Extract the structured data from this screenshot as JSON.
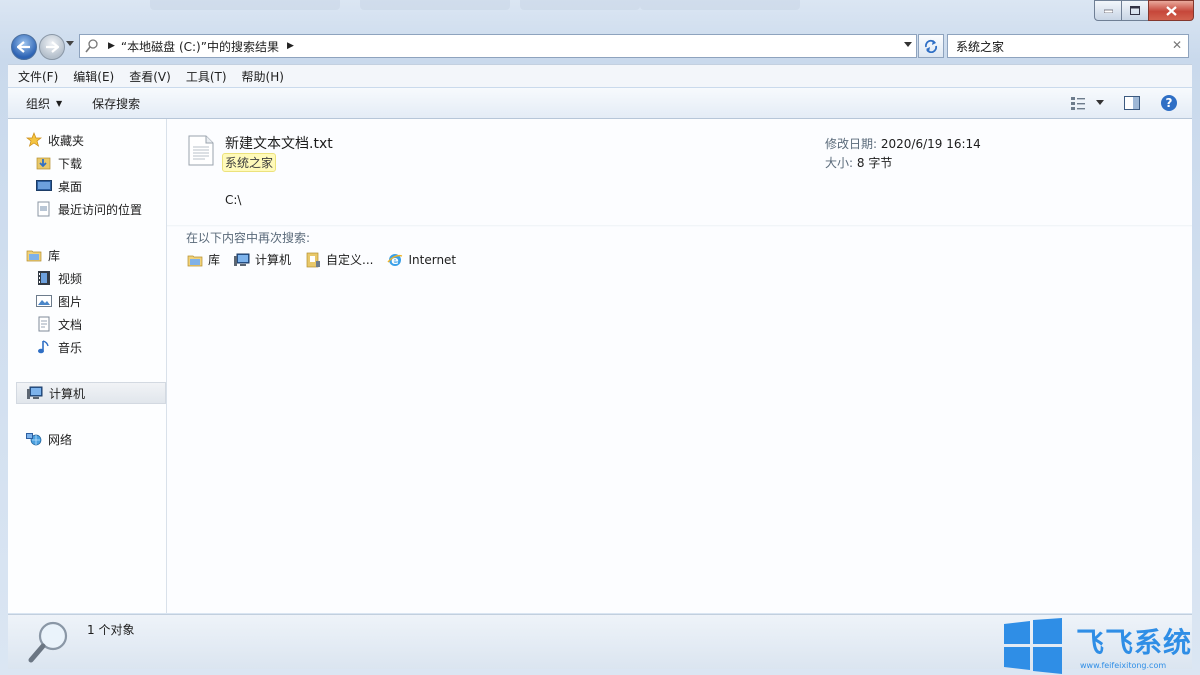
{
  "window": {
    "caption": {
      "minimize": "—",
      "maximize": "□",
      "close": "✕"
    }
  },
  "address": {
    "path": "“本地磁盘 (C:)”中的搜索结果",
    "search_value": "系统之家"
  },
  "menu": [
    "文件(F)",
    "编辑(E)",
    "查看(V)",
    "工具(T)",
    "帮助(H)"
  ],
  "toolbar": {
    "organize": "组织",
    "save_search": "保存搜索"
  },
  "sidebar": {
    "favorites": {
      "label": "收藏夹",
      "items": [
        "下载",
        "桌面",
        "最近访问的位置"
      ]
    },
    "libraries": {
      "label": "库",
      "items": [
        "视频",
        "图片",
        "文档",
        "音乐"
      ]
    },
    "computer": "计算机",
    "network": "网络"
  },
  "result": {
    "filename": "新建文本文档.txt",
    "match": "系统之家",
    "location": "C:\\",
    "modified_label": "修改日期:",
    "modified_value": "2020/6/19 16:14",
    "size_label": "大小:",
    "size_value": "8 字节"
  },
  "search_again": {
    "label": "在以下内容中再次搜索:",
    "locations": [
      "库",
      "计算机",
      "自定义...",
      "Internet"
    ]
  },
  "status": {
    "count": "1 个对象"
  },
  "watermark": {
    "brand": "飞飞系统",
    "url": "www.feifeixitong.com"
  },
  "colors": {
    "accent": "#2f8ee6",
    "highlight": "#fffaba",
    "selection": "#e1e6ec"
  }
}
